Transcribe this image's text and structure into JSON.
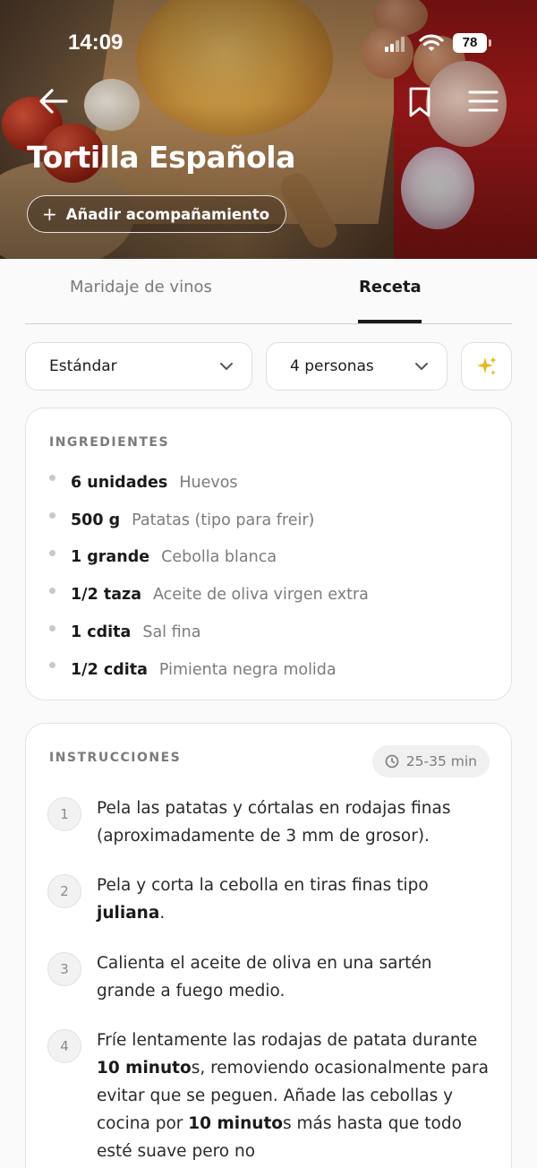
{
  "status_bar": {
    "time": "14:09",
    "battery": "78"
  },
  "header": {
    "title": "Tortilla Española",
    "add_side_label": "Añadir acompañamiento",
    "add_side_icon": "+"
  },
  "tabs": [
    {
      "label": "Maridaje de vinos",
      "active": false
    },
    {
      "label": "Receta",
      "active": true
    }
  ],
  "selectors": {
    "type": "Estándar",
    "people": "4 personas"
  },
  "colors": {
    "accent_sparkle": "#e8b820",
    "text_dark": "#1a1a1a",
    "text_muted": "#7c7c7c"
  },
  "ingredients": {
    "heading": "INGREDIENTES",
    "items": [
      {
        "qty": "6 unidades",
        "name": "Huevos"
      },
      {
        "qty": "500 g",
        "name": "Patatas (tipo para freir)"
      },
      {
        "qty": "1 grande",
        "name": "Cebolla blanca"
      },
      {
        "qty": "1/2 taza",
        "name": "Aceite de oliva virgen extra"
      },
      {
        "qty": "1 cdita",
        "name": "Sal fina"
      },
      {
        "qty": "1/2 cdita",
        "name": "Pimienta negra molida"
      }
    ]
  },
  "instructions": {
    "heading": "INSTRUCCIONES",
    "time": "25-35 min",
    "steps": [
      {
        "num": "1",
        "text": "Pela las patatas y córtalas en rodajas finas (aproximadamente de 3 mm de grosor)."
      },
      {
        "num": "2",
        "text_a": "Pela y corta la cebolla en tiras finas tipo ",
        "bold": "juliana",
        "text_b": "."
      },
      {
        "num": "3",
        "text": "Calienta el aceite de oliva en una sartén grande a fuego medio."
      },
      {
        "num": "4",
        "text_a": "Fríe lentamente las rodajas de patata durante ",
        "bold_a": "10 minuto",
        "text_b": "s, removiendo ocasionalmente para evitar que se peguen. Añade las cebollas y cocina por ",
        "bold_b": "10 minuto",
        "text_c": "s más hasta que todo esté suave pero no"
      }
    ]
  }
}
